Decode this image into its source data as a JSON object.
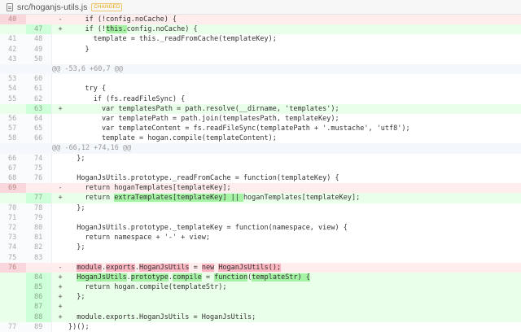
{
  "file": {
    "path": "src/hoganjs-utils.js",
    "status": "CHANGED",
    "icon": "file-icon"
  },
  "colors": {
    "deleted_bg": "#ffecec",
    "added_bg": "#eaffea",
    "deleted_highlight": "#fbb6c2",
    "added_highlight": "#a6f3a6"
  },
  "lines": [
    {
      "type": "del",
      "old": "40",
      "new": "",
      "sign": "-",
      "segments": [
        {
          "t": "    if (!config.noCache) {"
        }
      ]
    },
    {
      "type": "add",
      "old": "",
      "new": "47",
      "sign": "+",
      "segments": [
        {
          "t": "    if (!"
        },
        {
          "t": "this.",
          "hl": true
        },
        {
          "t": "config.noCache) {"
        }
      ]
    },
    {
      "type": "ctx",
      "old": "41",
      "new": "48",
      "sign": "",
      "segments": [
        {
          "t": "      template = this._readFromCache(templateKey);"
        }
      ]
    },
    {
      "type": "ctx",
      "old": "42",
      "new": "49",
      "sign": "",
      "segments": [
        {
          "t": "    }"
        }
      ]
    },
    {
      "type": "ctx",
      "old": "43",
      "new": "50",
      "sign": "",
      "segments": [
        {
          "t": ""
        }
      ]
    },
    {
      "type": "hunk",
      "old": "",
      "new": "",
      "sign": "",
      "segments": [
        {
          "t": "@@ -53,6 +60,7 @@"
        }
      ]
    },
    {
      "type": "ctx",
      "old": "53",
      "new": "60",
      "sign": "",
      "segments": [
        {
          "t": ""
        }
      ]
    },
    {
      "type": "ctx",
      "old": "54",
      "new": "61",
      "sign": "",
      "segments": [
        {
          "t": "    try {"
        }
      ]
    },
    {
      "type": "ctx",
      "old": "55",
      "new": "62",
      "sign": "",
      "segments": [
        {
          "t": "      if (fs.readFileSync) {"
        }
      ]
    },
    {
      "type": "add",
      "old": "",
      "new": "63",
      "sign": "+",
      "segments": [
        {
          "t": "        var templatesPath = path.resolve(__dirname, 'templates');"
        }
      ]
    },
    {
      "type": "ctx",
      "old": "56",
      "new": "64",
      "sign": "",
      "segments": [
        {
          "t": "        var templatePath = path.join(templatesPath, templateKey);"
        }
      ]
    },
    {
      "type": "ctx",
      "old": "57",
      "new": "65",
      "sign": "",
      "segments": [
        {
          "t": "        var templateContent = fs.readFileSync(templatePath + '.mustache', 'utf8');"
        }
      ]
    },
    {
      "type": "ctx",
      "old": "58",
      "new": "66",
      "sign": "",
      "segments": [
        {
          "t": "        template = hogan.compile(templateContent);"
        }
      ]
    },
    {
      "type": "hunk",
      "old": "",
      "new": "",
      "sign": "",
      "segments": [
        {
          "t": "@@ -66,12 +74,16 @@"
        }
      ]
    },
    {
      "type": "ctx",
      "old": "66",
      "new": "74",
      "sign": "",
      "segments": [
        {
          "t": "  };"
        }
      ]
    },
    {
      "type": "ctx",
      "old": "67",
      "new": "75",
      "sign": "",
      "segments": [
        {
          "t": ""
        }
      ]
    },
    {
      "type": "ctx",
      "old": "68",
      "new": "76",
      "sign": "",
      "segments": [
        {
          "t": "  HoganJsUtils.prototype._readFromCache = function(templateKey) {"
        }
      ]
    },
    {
      "type": "del",
      "old": "69",
      "new": "",
      "sign": "-",
      "segments": [
        {
          "t": "    return hoganTemplates[templateKey];"
        }
      ]
    },
    {
      "type": "add",
      "old": "",
      "new": "77",
      "sign": "+",
      "segments": [
        {
          "t": "    return "
        },
        {
          "t": "extraTemplates[templateKey] || ",
          "hl": true
        },
        {
          "t": "hoganTemplates[templateKey];"
        }
      ]
    },
    {
      "type": "ctx",
      "old": "70",
      "new": "78",
      "sign": "",
      "segments": [
        {
          "t": "  };"
        }
      ]
    },
    {
      "type": "ctx",
      "old": "71",
      "new": "79",
      "sign": "",
      "segments": [
        {
          "t": ""
        }
      ]
    },
    {
      "type": "ctx",
      "old": "72",
      "new": "80",
      "sign": "",
      "segments": [
        {
          "t": "  HoganJsUtils.prototype._templateKey = function(namespace, view) {"
        }
      ]
    },
    {
      "type": "ctx",
      "old": "73",
      "new": "81",
      "sign": "",
      "segments": [
        {
          "t": "    return namespace + '-' + view;"
        }
      ]
    },
    {
      "type": "ctx",
      "old": "74",
      "new": "82",
      "sign": "",
      "segments": [
        {
          "t": "  };"
        }
      ]
    },
    {
      "type": "ctx",
      "old": "75",
      "new": "83",
      "sign": "",
      "segments": [
        {
          "t": ""
        }
      ]
    },
    {
      "type": "del",
      "old": "76",
      "new": "",
      "sign": "-",
      "segments": [
        {
          "t": "  "
        },
        {
          "t": "module",
          "hl": true
        },
        {
          "t": "."
        },
        {
          "t": "exports",
          "hl": true
        },
        {
          "t": "."
        },
        {
          "t": "HoganJsUtils",
          "hl": true
        },
        {
          "t": " = "
        },
        {
          "t": "new",
          "hl": true
        },
        {
          "t": " "
        },
        {
          "t": "HoganJsUtils",
          "hl": true
        },
        {
          "t": "();",
          "hl": true
        }
      ]
    },
    {
      "type": "add",
      "old": "",
      "new": "84",
      "sign": "+",
      "segments": [
        {
          "t": "  "
        },
        {
          "t": "HoganJsUtils",
          "hl": true
        },
        {
          "t": "."
        },
        {
          "t": "prototype",
          "hl": true
        },
        {
          "t": "."
        },
        {
          "t": "compile",
          "hl": true
        },
        {
          "t": " = "
        },
        {
          "t": "function",
          "hl": true
        },
        {
          "t": "("
        },
        {
          "t": "templateStr",
          "hl": true
        },
        {
          "t": ") {",
          "hl": true
        }
      ]
    },
    {
      "type": "add",
      "old": "",
      "new": "85",
      "sign": "+",
      "segments": [
        {
          "t": "    return hogan.compile(templateStr);"
        }
      ]
    },
    {
      "type": "add",
      "old": "",
      "new": "86",
      "sign": "+",
      "segments": [
        {
          "t": "  };"
        }
      ]
    },
    {
      "type": "add",
      "old": "",
      "new": "87",
      "sign": "+",
      "segments": [
        {
          "t": ""
        }
      ]
    },
    {
      "type": "add",
      "old": "",
      "new": "88",
      "sign": "+",
      "segments": [
        {
          "t": "  module.exports.HoganJsUtils = HoganJsUtils;"
        }
      ]
    },
    {
      "type": "ctx",
      "old": "77",
      "new": "89",
      "sign": "",
      "segments": [
        {
          "t": "})();"
        }
      ]
    }
  ]
}
